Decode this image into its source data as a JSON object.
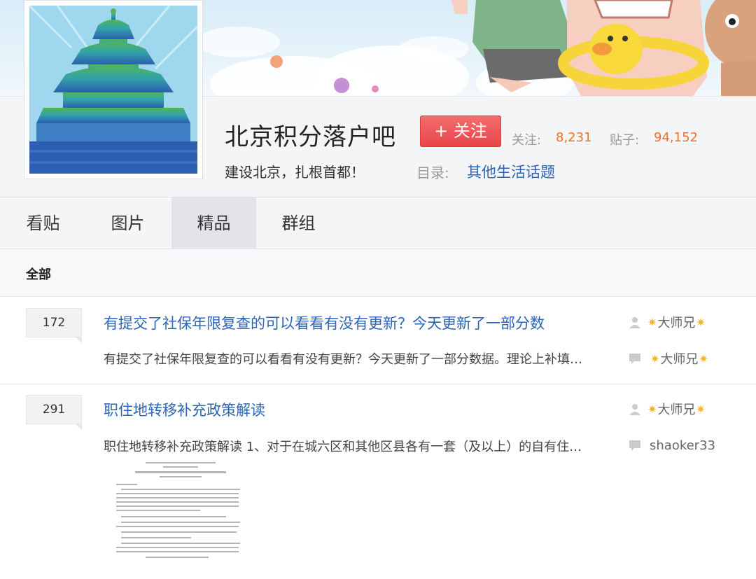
{
  "forum": {
    "title": "北京积分落户吧",
    "follow_label": "+ 关注",
    "follow_label_text": "关注",
    "slogan": "建设北京，扎根首都！",
    "stats": {
      "follow_label": "关注:",
      "follow_value": "8,231",
      "posts_label": "贴子:",
      "posts_value": "94,152"
    },
    "directory": {
      "label": "目录:",
      "value": "其他生活话题"
    }
  },
  "tabs": [
    {
      "label": "看贴",
      "active": false
    },
    {
      "label": "图片",
      "active": false
    },
    {
      "label": "精品",
      "active": true
    },
    {
      "label": "群组",
      "active": false
    }
  ],
  "filter": {
    "all_label": "全部"
  },
  "threads": [
    {
      "reply_count": "172",
      "title": "有提交了社保年限复查的可以看看有没有更新？今天更新了一部分数",
      "abstract": "有提交了社保年限复查的可以看看有没有更新？今天更新了一部分数据。理论上补填…",
      "author": "大师兄",
      "last_reply": "大师兄"
    },
    {
      "reply_count": "291",
      "title": "职住地转移补充政策解读",
      "abstract": "职住地转移补充政策解读 1、对于在城六区和其他区县各有一套（及以上）的自有住…",
      "author": "大师兄",
      "last_reply": "shaoker33"
    }
  ],
  "colors": {
    "link_blue": "#2d64b3",
    "follow_red": "#e94548",
    "stat_orange": "#f0722a"
  },
  "icons": {
    "author": "user-icon",
    "reply": "comment-icon",
    "medal": "star-icon"
  }
}
